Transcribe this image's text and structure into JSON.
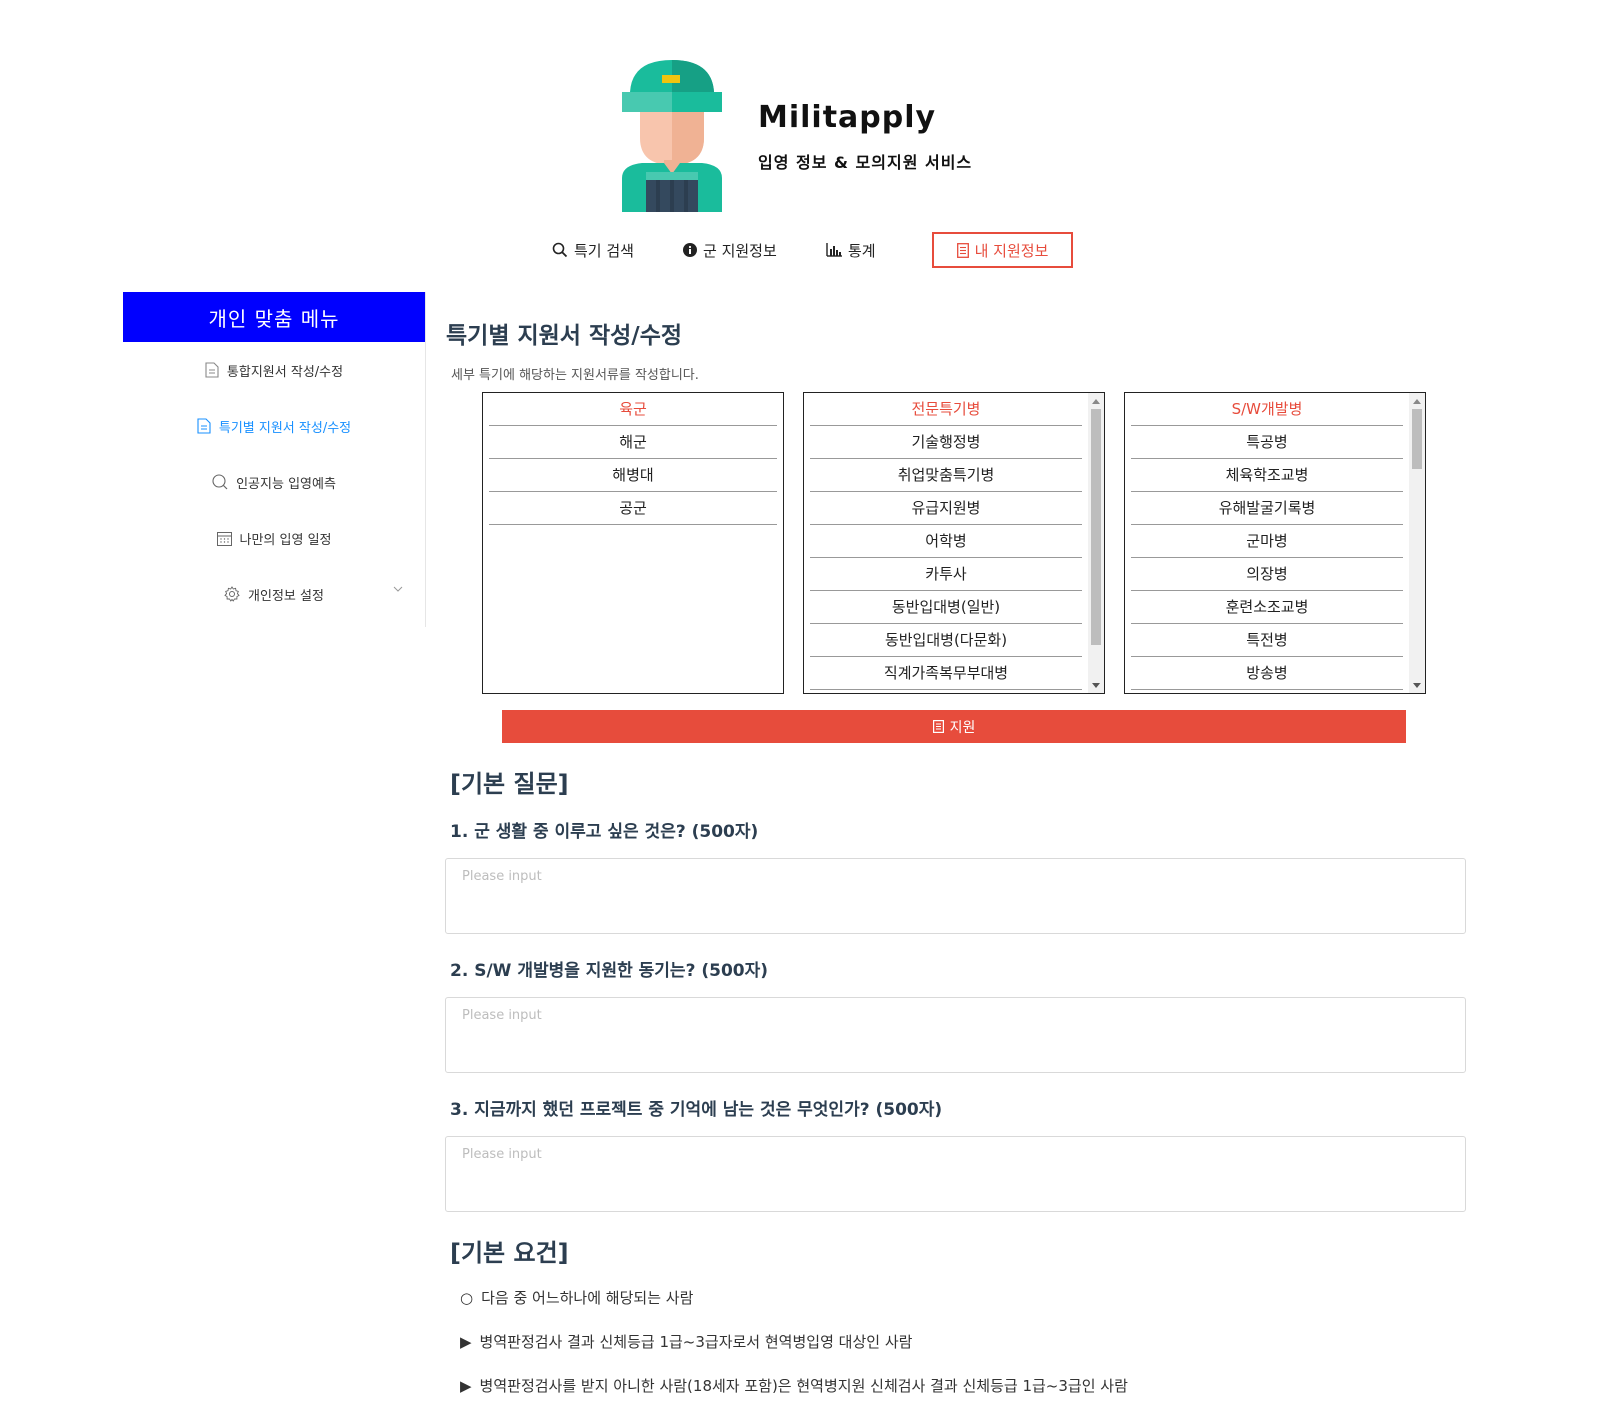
{
  "brand": {
    "name": "Militapply",
    "subtitle": "입영 정보 & 모의지원 서비스"
  },
  "topnav": [
    {
      "label": "특기 검색",
      "icon": "search-icon"
    },
    {
      "label": "군 지원정보",
      "icon": "info-icon"
    },
    {
      "label": "통계",
      "icon": "bar-chart-icon"
    },
    {
      "label": "내 지원정보",
      "icon": "document-icon",
      "active": true
    }
  ],
  "sidebar": {
    "header": "개인 맞춤 메뉴",
    "items": [
      {
        "label": "통합지원서 작성/수정",
        "icon": "file-icon"
      },
      {
        "label": "특기별 지원서 작성/수정",
        "icon": "file-icon",
        "active": true
      },
      {
        "label": "인공지능 입영예측",
        "icon": "search-icon"
      },
      {
        "label": "나만의 입영 일정",
        "icon": "calendar-icon"
      },
      {
        "label": "개인정보 설정",
        "icon": "gear-icon"
      }
    ]
  },
  "main": {
    "title": "특기별 지원서 작성/수정",
    "description": "세부 특기에 해당하는 지원서류를 작성합니다.",
    "branches": [
      "육군",
      "해군",
      "해병대",
      "공군"
    ],
    "categories": [
      "전문특기병",
      "기술행정병",
      "취업맞춤특기병",
      "유급지원병",
      "어학병",
      "카투사",
      "동반입대병(일반)",
      "동반입대병(다문화)",
      "직계가족복무부대병"
    ],
    "specialties": [
      "S/W개발병",
      "특공병",
      "체육학조교병",
      "유해발굴기록병",
      "군마병",
      "의장병",
      "훈련소조교병",
      "특전병",
      "방송병"
    ],
    "apply_label": "지원"
  },
  "basic_questions": {
    "title": "[기본 질문]",
    "questions": [
      {
        "label": "1. 군 생활 중 이루고 싶은 것은? (500자)",
        "placeholder": "Please input"
      },
      {
        "label": "2. S/W 개발병을 지원한 동기는? (500자)",
        "placeholder": "Please input"
      },
      {
        "label": "3. 지금까지 했던 프로젝트 중 기억에 남는 것은 무엇인가? (500자)",
        "placeholder": "Please input"
      }
    ]
  },
  "requirements": {
    "title": "[기본 요건]",
    "items": [
      {
        "bullet": "○",
        "text": "다음 중 어느하나에 해당되는 사람"
      },
      {
        "bullet": "▶",
        "text": "병역판정검사 결과 신체등급 1급~3급자로서 현역병입영 대상인 사람"
      },
      {
        "bullet": "▶",
        "text": "병역판정검사를 받지 아니한 사람(18세자 포함)은 현역병지원 신체검사 결과 신체등급 1급~3급인 사람"
      }
    ]
  },
  "colors": {
    "accent": "#e74c3c",
    "sidebar_header": "#0000ff",
    "active_link": "#1890ff"
  }
}
